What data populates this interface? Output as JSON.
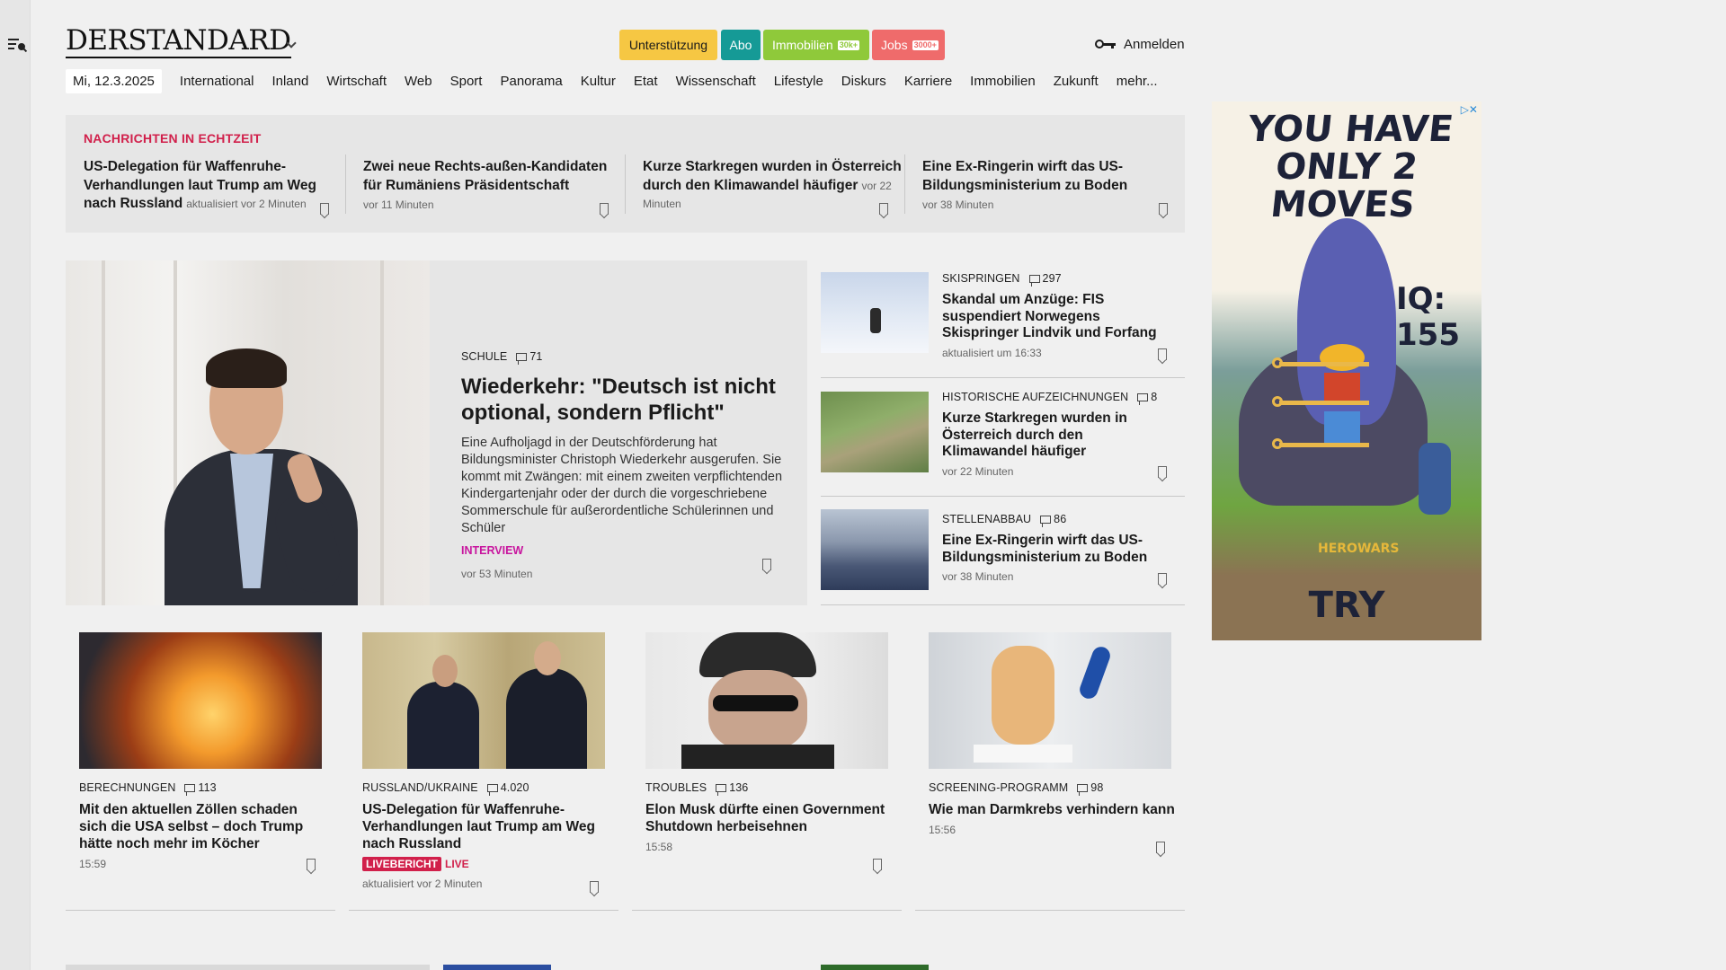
{
  "header": {
    "logo_text": "DERSTANDARD",
    "buttons": {
      "support": "Unterstützung",
      "abo": "Abo",
      "immobilien": "Immobilien",
      "immobilien_badge": "30k+",
      "jobs": "Jobs",
      "jobs_badge": "3000+"
    },
    "login": "Anmelden"
  },
  "nav": {
    "date": "Mi, 12.3.2025",
    "items": [
      "International",
      "Inland",
      "Wirtschaft",
      "Web",
      "Sport",
      "Panorama",
      "Kultur",
      "Etat",
      "Wissenschaft",
      "Lifestyle",
      "Diskurs",
      "Karriere",
      "Immobilien",
      "Zukunft",
      "mehr..."
    ]
  },
  "live": {
    "kicker": "NACHRICHTEN IN ECHTZEIT",
    "items": [
      {
        "title": "US-Delegation für Waffenruhe-Verhandlungen laut Trump am Weg nach Russland",
        "meta": "aktualisiert vor 2 Minuten"
      },
      {
        "title": "Zwei neue Rechts-außen-Kandidaten für Rumäniens Präsidentschaft",
        "meta": "vor 11 Minuten"
      },
      {
        "title": "Kurze Starkregen wurden in Österreich durch den Klimawandel häufiger",
        "meta": "vor 22 Minuten"
      },
      {
        "title": "Eine Ex-Ringerin wirft das US-Bildungsministerium zu Boden",
        "meta": "vor 38 Minuten"
      }
    ]
  },
  "hero": {
    "kicker": "SCHULE",
    "comments": "71",
    "title": "Wiederkehr: \"Deutsch ist nicht optional, sondern Pflicht\"",
    "lead": "Eine Aufholjagd in der Deutschförderung hat Bildungsminister Christoph Wiederkehr ausgerufen. Sie kommt mit Zwängen: mit einem zweiten verpflichtenden Kindergartenjahr oder der durch die vorgeschriebene Sommerschule für außerordentliche Schülerinnen und Schüler",
    "tag": "INTERVIEW",
    "time": "vor 53 Minuten"
  },
  "side": [
    {
      "kicker": "SKISPRINGEN",
      "comments": "297",
      "title": "Skandal um Anzüge: FIS suspendiert Norwegens Skispringer Lindvik und Forfang",
      "time": "aktualisiert um 16:33"
    },
    {
      "kicker": "HISTORISCHE AUFZEICHNUNGEN",
      "comments": "8",
      "title": "Kurze Starkregen wurden in Österreich durch den Klimawandel häufiger",
      "time": "vor 22 Minuten"
    },
    {
      "kicker": "STELLENABBAU",
      "comments": "86",
      "title": "Eine Ex-Ringerin wirft das US-Bildungsministerium zu Boden",
      "time": "vor 38 Minuten"
    }
  ],
  "cards": [
    {
      "kicker": "BERECHNUNGEN",
      "comments": "113",
      "title": "Mit den aktuellen Zöllen schaden sich die USA selbst – doch Trump hätte noch mehr im Köcher",
      "time": "15:59"
    },
    {
      "kicker": "RUSSLAND/UKRAINE",
      "comments": "4.020",
      "title": "US-Delegation für Waffenruhe-Verhandlungen laut Trump am Weg nach Russland",
      "live_label": "LIVEBERICHT",
      "live_text": "LIVE",
      "time": "aktualisiert vor 2 Minuten"
    },
    {
      "kicker": "TROUBLES",
      "comments": "136",
      "title": "Elon Musk dürfte einen Government Shutdown herbeisehnen",
      "time": "15:58"
    },
    {
      "kicker": "SCREENING-PROGRAMM",
      "comments": "98",
      "title": "Wie man Darmkrebs verhindern kann",
      "time": "15:56"
    }
  ],
  "ad": {
    "headline": "YOU HAVE ONLY 2 MOVES",
    "iq": "IQ: 155",
    "brand": "HEROWARS",
    "cta": "TRY"
  },
  "colors": {
    "accent_red": "#d1204b",
    "support_yellow": "#f6c743",
    "abo_teal": "#159a96",
    "immo_green": "#8fc93a",
    "jobs_red": "#ef6b6b",
    "interview_magenta": "#c8159e"
  }
}
